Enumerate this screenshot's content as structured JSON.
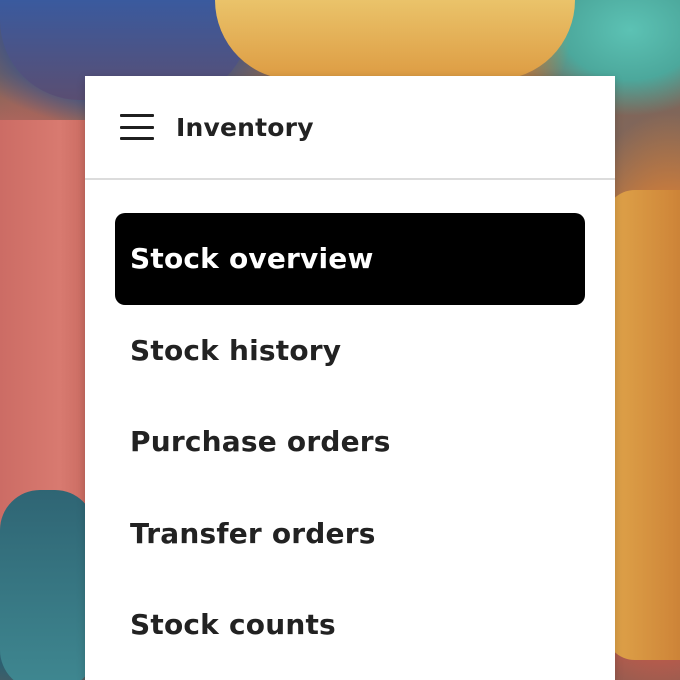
{
  "header": {
    "title": "Inventory",
    "menu_icon": "hamburger-menu-icon"
  },
  "nav": {
    "active_index": 0,
    "items": [
      {
        "label": "Stock overview"
      },
      {
        "label": "Stock history"
      },
      {
        "label": "Purchase orders"
      },
      {
        "label": "Transfer orders"
      },
      {
        "label": "Stock counts"
      }
    ]
  },
  "colors": {
    "drawer_background": "#ffffff",
    "active_item_background": "#000000",
    "active_item_text": "#ffffff",
    "text": "#222222",
    "divider": "#dcdcdc"
  }
}
